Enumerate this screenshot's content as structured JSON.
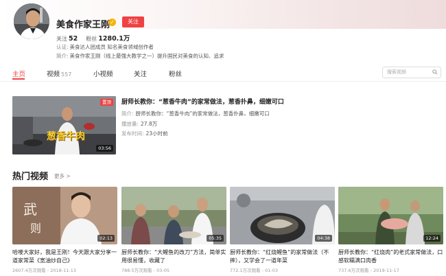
{
  "profile": {
    "name": "美食作家王刚",
    "follow_label": "关注",
    "following_label": "关注",
    "following_count": "52",
    "fans_label": "粉丝",
    "fans_count": "1280.1万",
    "cert_label": "认证:",
    "cert_value": "美食达人团成员 知名美食领域创作者",
    "intro_label": "简介:",
    "intro_value": "美食作家王刚（线上最强大教学之一）提升国民对美食的认知、追求"
  },
  "tabs": [
    {
      "label": "主页",
      "count": ""
    },
    {
      "label": "视频",
      "count": "557"
    },
    {
      "label": "小视频",
      "count": ""
    },
    {
      "label": "关注",
      "count": ""
    },
    {
      "label": "粉丝",
      "count": ""
    }
  ],
  "search": {
    "placeholder": "搜索视频"
  },
  "featured": {
    "badge": "置顶",
    "duration": "03:56",
    "thumb_caption": "葱香牛肉",
    "title": "厨师长教你：“葱香牛肉”的家常做法，葱香扑鼻，细嫩可口",
    "intro_label": "简介:",
    "intro_value": "厨师长教你：“葱香牛肉”的家常做法，葱香扑鼻，细嫩可口",
    "plays_label": "播放量:",
    "plays_value": "27.8万",
    "time_label": "发布时间:",
    "time_value": "23小时前"
  },
  "hot": {
    "title": "热门视频",
    "more": "更多 >",
    "videos": [
      {
        "title": "哈喽大家好，我是王刚！今天跟大家分享一道家常菜《宽油炒自己》",
        "duration": "02:13",
        "meta": "2607.4万次观看 - 2018-11-13"
      },
      {
        "title": "厨师长教你：“大鲤鱼的改刀”方法，简单实用很易懂，收藏了",
        "duration": "05:35",
        "meta": "788.5万次观看 - 03-05"
      },
      {
        "title": "厨师长教你：“红烧鲤鱼”的家常做法（不摔），又学会了一道年菜",
        "duration": "04:38",
        "meta": "772.1万次观看 - 01-03"
      },
      {
        "title": "厨师长教你：“红烧肉”的老式家常做法，口感软糯满口肉香",
        "duration": "12:24",
        "meta": "737.6万次观看 - 2019-11-17"
      }
    ]
  },
  "colors": {
    "accent": "#f04142",
    "verified": "#f5b400"
  }
}
